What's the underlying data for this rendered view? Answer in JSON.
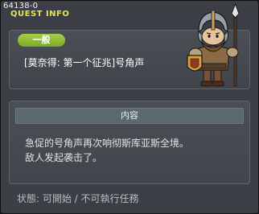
{
  "window": {
    "quest_id": "64138-0",
    "title": "QUEST INFO"
  },
  "quest": {
    "category": "一般",
    "name": "[莫奈得: 第一个征兆]号角声",
    "npc_icon": "armored-knight-npc-portrait"
  },
  "content": {
    "header": "内容",
    "lines": [
      "急促的号角声再次响彻斯库亚斯全境。",
      "敌人发起袭击了。"
    ]
  },
  "status": {
    "text": "状態: 可開始 / 不可執行任務"
  },
  "colors": {
    "title_yellow": "#e9e052",
    "badge_green": "#8fbe34",
    "window_bg": "#3b3f45",
    "panel_bg": "#464a50",
    "header_bg": "#5c6770"
  }
}
